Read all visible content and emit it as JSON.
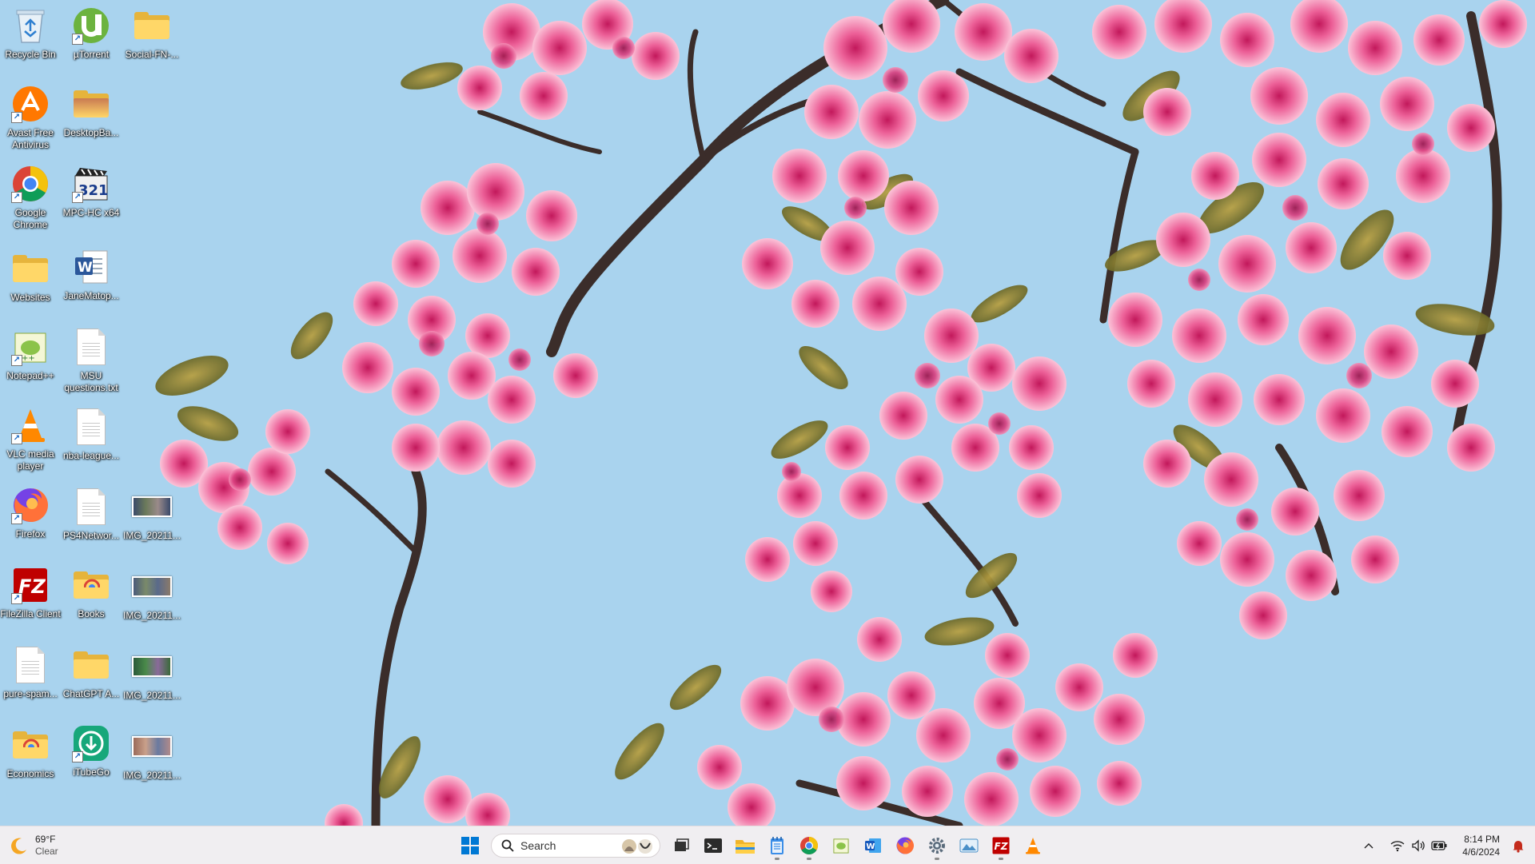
{
  "desktop": {
    "icons": [
      {
        "label": "Recycle Bin",
        "icon": "recycle-bin-icon"
      },
      {
        "label": "µTorrent",
        "icon": "utorrent-icon"
      },
      {
        "label": "Social-FN-...",
        "icon": "folder-icon"
      },
      {
        "label": "Avast Free Antivirus",
        "icon": "avast-icon"
      },
      {
        "label": "DesktopBa...",
        "icon": "folder-icon"
      },
      {
        "label": "Google Chrome",
        "icon": "chrome-icon"
      },
      {
        "label": "MPC-HC x64",
        "icon": "mpc-hc-icon"
      },
      {
        "label": "Websites",
        "icon": "folder-icon"
      },
      {
        "label": "JaneMatop...",
        "icon": "word-document-icon"
      },
      {
        "label": "Notepad++",
        "icon": "notepad-plus-plus-icon"
      },
      {
        "label": "MSU questions.txt",
        "icon": "text-file-icon"
      },
      {
        "label": "VLC media player",
        "icon": "vlc-icon"
      },
      {
        "label": "nba-league...",
        "icon": "text-file-icon"
      },
      {
        "label": "Firefox",
        "icon": "firefox-icon"
      },
      {
        "label": "PS4Networ...",
        "icon": "text-file-icon"
      },
      {
        "label": "IMG_20211...",
        "icon": "image-file-icon"
      },
      {
        "label": "FileZilla Client",
        "icon": "filezilla-icon"
      },
      {
        "label": "Books",
        "icon": "folder-icon"
      },
      {
        "label": "IMG_20211...",
        "icon": "image-file-icon"
      },
      {
        "label": "pure-spam...",
        "icon": "text-file-icon"
      },
      {
        "label": "ChatGPT A...",
        "icon": "folder-icon"
      },
      {
        "label": "IMG_20211...",
        "icon": "image-file-icon"
      },
      {
        "label": "Economics",
        "icon": "folder-icon"
      },
      {
        "label": "iTubeGo",
        "icon": "itubego-icon"
      },
      {
        "label": "IMG_20211...",
        "icon": "image-file-icon"
      }
    ]
  },
  "taskbar": {
    "weather": {
      "temp": "69°F",
      "condition": "Clear",
      "icon": "moon-icon"
    },
    "search_placeholder": "Search",
    "pinned": [
      {
        "name": "start-button",
        "icon": "windows-icon"
      },
      {
        "name": "task-view",
        "icon": "task-view-icon"
      },
      {
        "name": "terminal",
        "icon": "terminal-icon"
      },
      {
        "name": "file-explorer",
        "icon": "file-explorer-icon"
      },
      {
        "name": "notepad",
        "icon": "notepad-icon"
      },
      {
        "name": "chrome",
        "icon": "chrome-icon"
      },
      {
        "name": "notepad-plus-plus",
        "icon": "notepad-plus-plus-icon"
      },
      {
        "name": "word",
        "icon": "word-icon"
      },
      {
        "name": "firefox",
        "icon": "firefox-icon"
      },
      {
        "name": "settings",
        "icon": "settings-icon"
      },
      {
        "name": "photos",
        "icon": "photos-icon"
      },
      {
        "name": "filezilla",
        "icon": "filezilla-icon"
      },
      {
        "name": "vlc",
        "icon": "vlc-icon"
      }
    ],
    "clock": {
      "time": "8:14 PM",
      "date": "4/6/2024"
    }
  },
  "colors": {
    "sky": "#a9d3ee",
    "blossom": "#f06fa0",
    "accent": "#0067c0"
  }
}
